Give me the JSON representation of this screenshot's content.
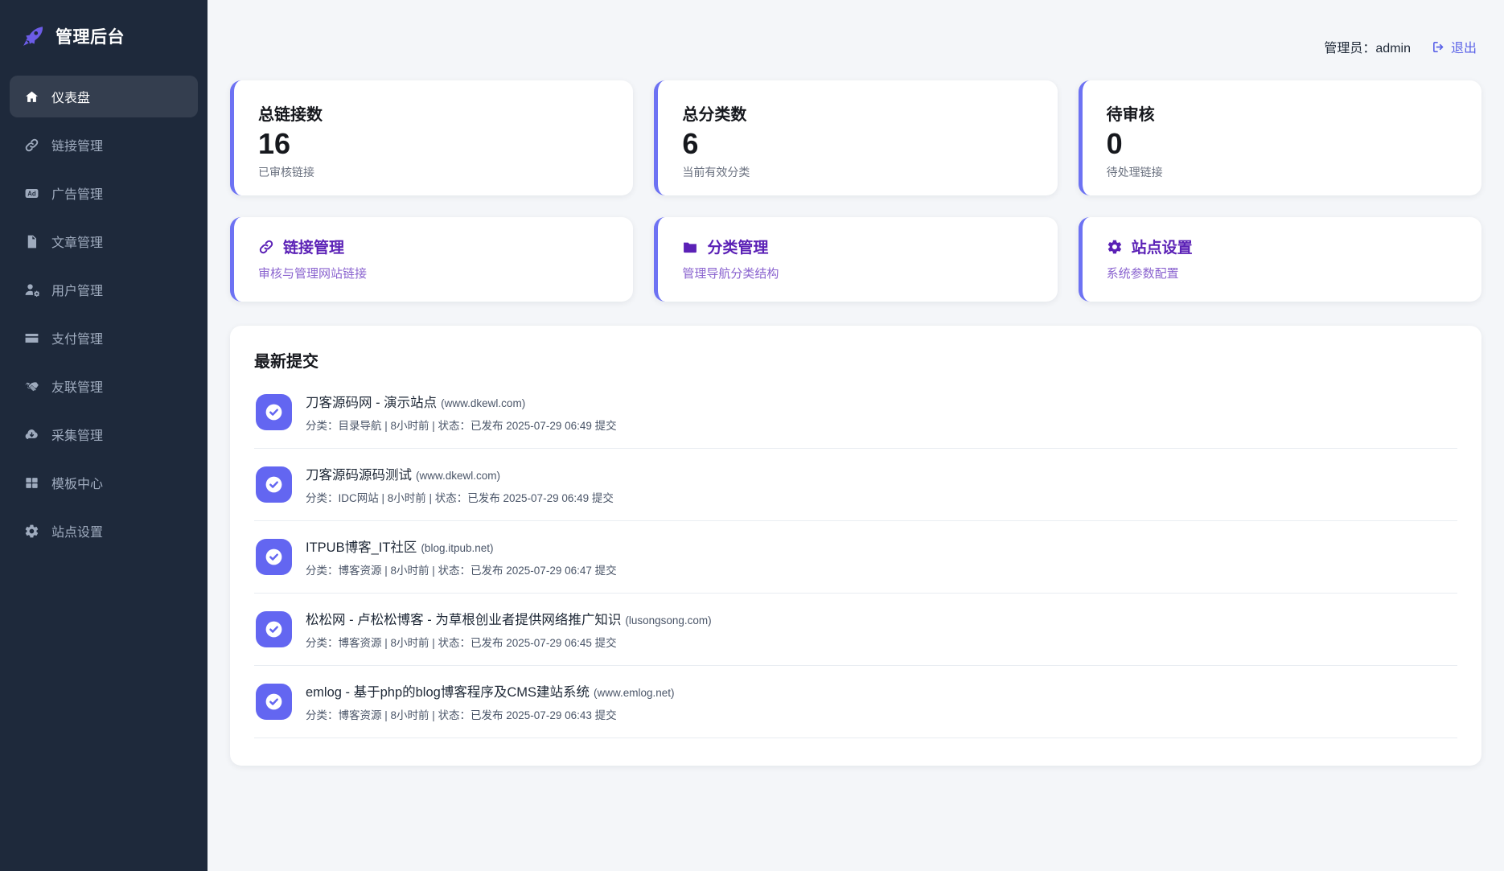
{
  "app": {
    "title": "管理后台",
    "logo_icon": "rocket-icon"
  },
  "header": {
    "admin_label": "管理员：",
    "admin_name": "admin",
    "logout_label": "退出",
    "logout_icon": "logout-icon"
  },
  "sidebar": {
    "items": [
      {
        "label": "仪表盘",
        "icon": "home-icon",
        "active": true
      },
      {
        "label": "链接管理",
        "icon": "link-icon",
        "active": false
      },
      {
        "label": "广告管理",
        "icon": "ad-icon",
        "active": false
      },
      {
        "label": "文章管理",
        "icon": "file-icon",
        "active": false
      },
      {
        "label": "用户管理",
        "icon": "user-gear-icon",
        "active": false
      },
      {
        "label": "支付管理",
        "icon": "credit-card-icon",
        "active": false
      },
      {
        "label": "友联管理",
        "icon": "handshake-icon",
        "active": false
      },
      {
        "label": "采集管理",
        "icon": "cloud-download-icon",
        "active": false
      },
      {
        "label": "模板中心",
        "icon": "grid-icon",
        "active": false
      },
      {
        "label": "站点设置",
        "icon": "gear-icon",
        "active": false
      }
    ]
  },
  "stats": [
    {
      "title": "总链接数",
      "value": "16",
      "subtitle": "已审核链接"
    },
    {
      "title": "总分类数",
      "value": "6",
      "subtitle": "当前有效分类"
    },
    {
      "title": "待审核",
      "value": "0",
      "subtitle": "待处理链接"
    }
  ],
  "quick_actions": [
    {
      "title": "链接管理",
      "icon": "link-icon",
      "subtitle": "审核与管理网站链接"
    },
    {
      "title": "分类管理",
      "icon": "folder-icon",
      "subtitle": "管理导航分类结构"
    },
    {
      "title": "站点设置",
      "icon": "gear-icon",
      "subtitle": "系统参数配置"
    }
  ],
  "recent": {
    "title": "最新提交",
    "item_icon": "check-circle-icon",
    "items": [
      {
        "name": "刀客源码网 - 演示站点",
        "domain": "(www.dkewl.com)",
        "meta": "分类：目录导航 | 8小时前 | 状态：已发布 2025-07-29 06:49 提交"
      },
      {
        "name": "刀客源码源码测试",
        "domain": "(www.dkewl.com)",
        "meta": "分类：IDC网站 | 8小时前 | 状态：已发布 2025-07-29 06:49 提交"
      },
      {
        "name": "ITPUB博客_IT社区",
        "domain": "(blog.itpub.net)",
        "meta": "分类：博客资源 | 8小时前 | 状态：已发布 2025-07-29 06:47 提交"
      },
      {
        "name": "松松网 - 卢松松博客 - 为草根创业者提供网络推广知识",
        "domain": "(lusongsong.com)",
        "meta": "分类：博客资源 | 8小时前 | 状态：已发布 2025-07-29 06:45 提交"
      },
      {
        "name": "emlog - 基于php的blog博客程序及CMS建站系统",
        "domain": "(www.emlog.net)",
        "meta": "分类：博客资源 | 8小时前 | 状态：已发布 2025-07-29 06:43 提交"
      }
    ]
  },
  "colors": {
    "sidebar_bg": "#1e293b",
    "page_bg": "#f4f6f9",
    "accent": "#6366f1",
    "card_accent_border": "#6d72f3",
    "logo_purple": "#6c5ce7",
    "action_title_purple": "#5b21b6",
    "action_sub_purple": "#8a63cf",
    "logout_link": "#5b63e8"
  }
}
